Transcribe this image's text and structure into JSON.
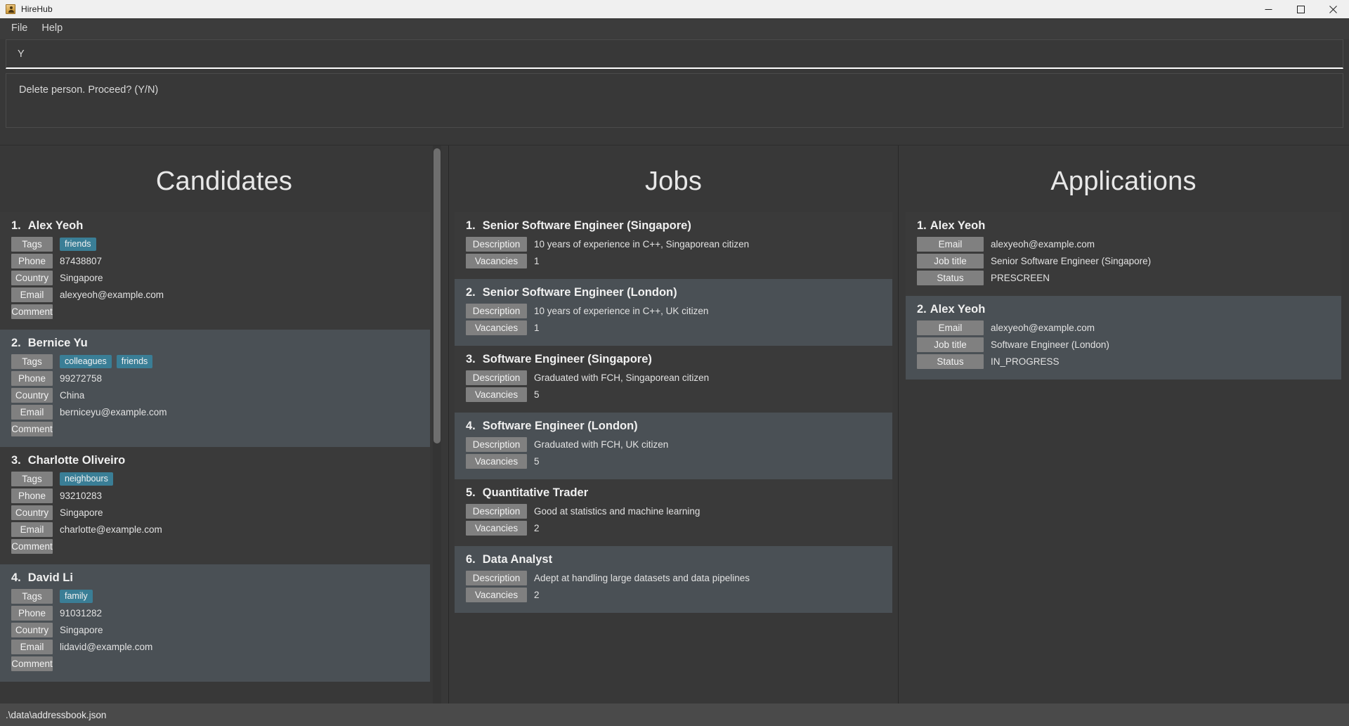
{
  "window": {
    "title": "HireHub",
    "icon": "addressbook-icon",
    "minimize_label": "Minimize",
    "maximize_label": "Maximize",
    "close_label": "Close"
  },
  "menubar": {
    "items": [
      {
        "label": "File",
        "name": "menu-file"
      },
      {
        "label": "Help",
        "name": "menu-help"
      }
    ]
  },
  "command": {
    "value": "Y",
    "placeholder": "Enter command here..."
  },
  "result": {
    "message": "Delete person. Proceed? (Y/N)"
  },
  "panels": {
    "candidates": {
      "title": "Candidates",
      "labels": {
        "tags": "Tags",
        "phone": "Phone",
        "country": "Country",
        "email": "Email",
        "comment": "Comment"
      },
      "items": [
        {
          "index": "1.",
          "name": "Alex Yeoh",
          "tags": [
            "friends"
          ],
          "phone": "87438807",
          "country": "Singapore",
          "email": "alexyeoh@example.com",
          "comment": ""
        },
        {
          "index": "2.",
          "name": "Bernice Yu",
          "tags": [
            "colleagues",
            "friends"
          ],
          "phone": "99272758",
          "country": "China",
          "email": "berniceyu@example.com",
          "comment": ""
        },
        {
          "index": "3.",
          "name": "Charlotte Oliveiro",
          "tags": [
            "neighbours"
          ],
          "phone": "93210283",
          "country": "Singapore",
          "email": "charlotte@example.com",
          "comment": ""
        },
        {
          "index": "4.",
          "name": "David Li",
          "tags": [
            "family"
          ],
          "phone": "91031282",
          "country": "Singapore",
          "email": "lidavid@example.com",
          "comment": ""
        }
      ]
    },
    "jobs": {
      "title": "Jobs",
      "labels": {
        "description": "Description",
        "vacancies": "Vacancies"
      },
      "items": [
        {
          "index": "1.",
          "title": "Senior Software Engineer (Singapore)",
          "description": "10 years of experience in C++, Singaporean citizen",
          "vacancies": "1"
        },
        {
          "index": "2.",
          "title": "Senior Software Engineer (London)",
          "description": "10 years of experience in C++, UK citizen",
          "vacancies": "1"
        },
        {
          "index": "3.",
          "title": "Software Engineer (Singapore)",
          "description": "Graduated with FCH, Singaporean citizen",
          "vacancies": "5"
        },
        {
          "index": "4.",
          "title": "Software Engineer (London)",
          "description": "Graduated with FCH, UK citizen",
          "vacancies": "5"
        },
        {
          "index": "5.",
          "title": "Quantitative Trader",
          "description": "Good at statistics and machine learning",
          "vacancies": "2"
        },
        {
          "index": "6.",
          "title": "Data Analyst",
          "description": "Adept at handling large datasets and data pipelines",
          "vacancies": "2"
        }
      ]
    },
    "applications": {
      "title": "Applications",
      "labels": {
        "email": "Email",
        "job_title": "Job title",
        "status": "Status"
      },
      "items": [
        {
          "index": "1.",
          "name": "Alex Yeoh",
          "email": "alexyeoh@example.com",
          "job_title": "Senior Software Engineer (Singapore)",
          "status": "PRESCREEN"
        },
        {
          "index": "2.",
          "name": "Alex Yeoh",
          "email": "alexyeoh@example.com",
          "job_title": "Software Engineer (London)",
          "status": "IN_PROGRESS"
        }
      ]
    }
  },
  "statusbar": {
    "file_path": ".\\data\\addressbook.json"
  },
  "colors": {
    "accent_tag": "#3a7e96",
    "chip": "#808080",
    "panel_bg": "#383838",
    "card_alt": "#4a5055"
  }
}
